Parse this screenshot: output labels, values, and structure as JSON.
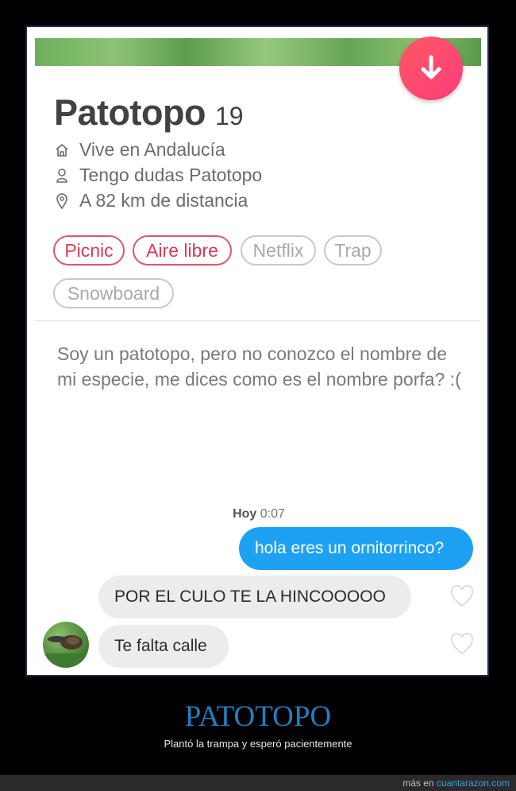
{
  "profile": {
    "name": "Patotopo",
    "age": "19",
    "location": "Vive en Andalucía",
    "job": "Tengo dudas Patotopo",
    "distance": "A 82 km de distancia",
    "interests": [
      {
        "label": "Picnic",
        "shared": true
      },
      {
        "label": "Aire libre",
        "shared": true
      },
      {
        "label": "Netflix",
        "shared": false
      },
      {
        "label": "Trap",
        "shared": false
      },
      {
        "label": "Snowboard",
        "shared": false
      }
    ],
    "bio": "Soy un patotopo, pero no conozco el nombre de mi especie, me dices como es el nombre porfa? :("
  },
  "chat": {
    "timestamp_day": "Hoy",
    "timestamp_time": "0:07",
    "messages": [
      {
        "from": "me",
        "text": "hola eres un ornitorrinco?"
      },
      {
        "from": "them",
        "text": "POR EL CULO TE LA HINCOOOOO"
      },
      {
        "from": "them",
        "text": "Te falta calle"
      }
    ]
  },
  "caption": {
    "title": "PATOTOPO",
    "subtitle": "Plantó la trampa y esperó pacientemente"
  },
  "footer": {
    "prefix": "más en",
    "link": "cuantarazon.com"
  },
  "colors": {
    "accent_gradient_start": "#fd5a64",
    "accent_gradient_end": "#fe3b7a",
    "outgoing_bubble": "#1ea1f3",
    "incoming_bubble": "#ececec",
    "shared_interest": "#e0566a"
  }
}
